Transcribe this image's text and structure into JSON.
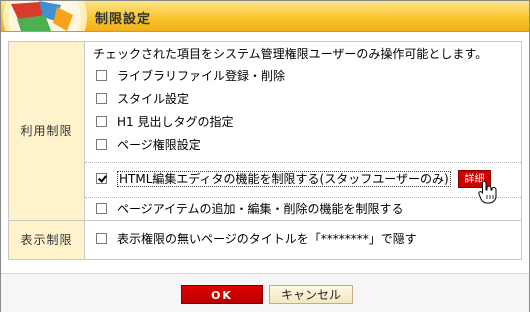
{
  "dialog": {
    "title": "制限設定"
  },
  "usage": {
    "label": "利用制限",
    "description": "チェックされた項目をシステム管理権限ユーザーのみ操作可能とします。",
    "options": [
      {
        "label": "ライブラリファイル登録・削除",
        "checked": false
      },
      {
        "label": "スタイル設定",
        "checked": false
      },
      {
        "label": "H1 見出しタグの指定",
        "checked": false
      },
      {
        "label": "ページ権限設定",
        "checked": false
      }
    ],
    "html_editor": {
      "label": "HTML編集エディタの機能を制限する(スタッフユーザーのみ)",
      "checked": true,
      "detail_button": "詳細"
    },
    "page_item": {
      "label": "ページアイテムの追加・編集・削除の機能を制限する",
      "checked": false
    }
  },
  "display": {
    "label": "表示制限",
    "option": {
      "label": "表示権限の無いページのタイトルを「********」で隠す",
      "checked": false
    }
  },
  "buttons": {
    "ok": "OK",
    "cancel": "キャンセル"
  },
  "colors": {
    "title_bar": "#f8c52f",
    "label_bg": "#fff3cc",
    "ok_button": "#cc0000",
    "cancel_button": "#f3e7c3"
  },
  "icons": [
    "app-logo-icon",
    "hand-cursor-icon",
    "checkmark-icon"
  ]
}
